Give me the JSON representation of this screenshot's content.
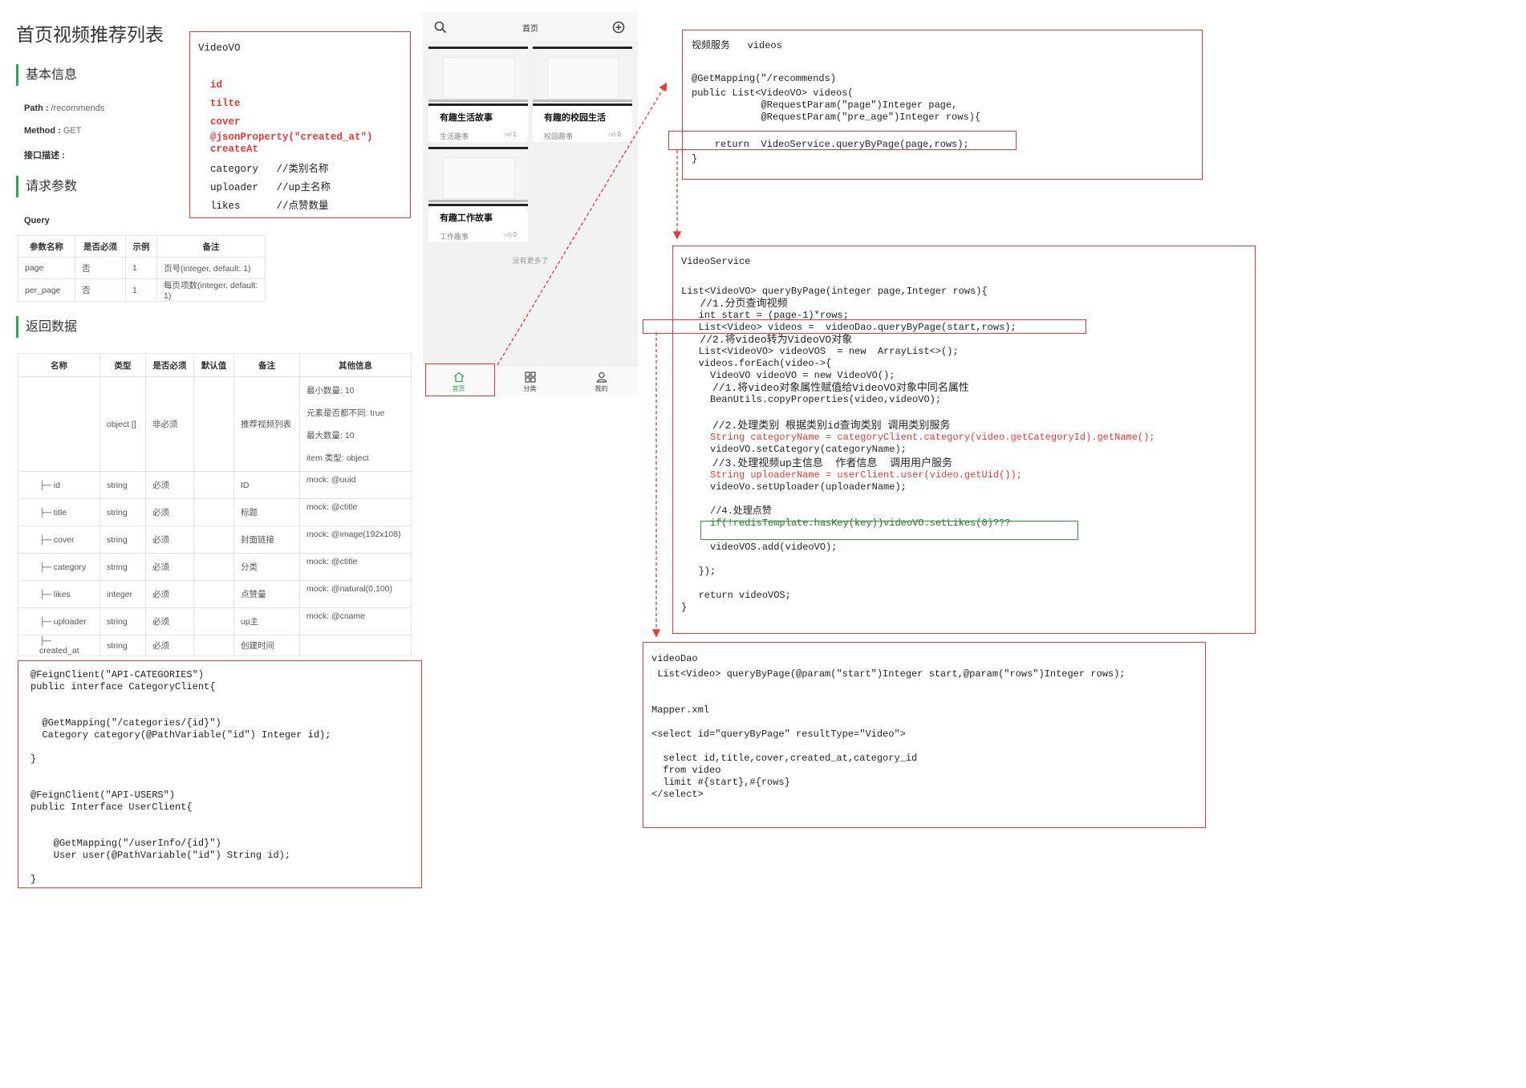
{
  "doc": {
    "title": "首页视频推荐列表",
    "basic_info_heading": "基本信息",
    "path_label": "Path :",
    "path_value": "/recommends",
    "method_label": "Method :",
    "method_value": "GET",
    "desc_label": "接口描述 :",
    "request_params_heading": "请求参数",
    "query_label": "Query",
    "query_table": {
      "headers": [
        "参数名称",
        "是否必须",
        "示例",
        "备注"
      ],
      "rows": [
        [
          "page",
          "否",
          "1",
          "页号(integer, default: 1)"
        ],
        [
          "per_page",
          "否",
          "1",
          "每页项数(integer, default: 1)"
        ]
      ]
    },
    "response_heading": "返回数据",
    "response_table": {
      "headers": [
        "名称",
        "类型",
        "是否必须",
        "默认值",
        "备注",
        "其他信息"
      ],
      "root": {
        "type": "object []",
        "required": "非必须",
        "default": "",
        "note": "推荐视频列表",
        "other": [
          "最小数量: 10",
          "元素是否都不同: true",
          "最大数量: 10",
          "item 类型: object"
        ]
      },
      "rows": [
        [
          "├─ id",
          "string",
          "必须",
          "",
          "ID",
          "mock: @uuid"
        ],
        [
          "├─ title",
          "string",
          "必须",
          "",
          "标题",
          "mock: @ctitle"
        ],
        [
          "├─ cover",
          "string",
          "必须",
          "",
          "封面链接",
          "mock: @image(192x108)"
        ],
        [
          "├─ category",
          "string",
          "必须",
          "",
          "分类",
          "mock: @ctitle"
        ],
        [
          "├─ likes",
          "integer",
          "必须",
          "",
          "点赞量",
          "mock: @natural(0,100)"
        ],
        [
          "├─ uploader",
          "string",
          "必须",
          "",
          "up主",
          "mock: @cname"
        ],
        [
          "├─ created_at",
          "string",
          "必须",
          "",
          "创建时间",
          ""
        ]
      ]
    }
  },
  "videovo_box": {
    "lines": [
      "VideoVO",
      "",
      "  id",
      "  tilte",
      "  cover",
      "  @jsonProperty(\"created_at\")",
      "  createAt",
      "  category   //类别名称",
      "  uploader   //up主名称",
      "  likes      //点赞数量"
    ]
  },
  "phone": {
    "header_title": "首页",
    "cards": [
      {
        "title": "有趣生活故事",
        "category": "生活趣事",
        "likes": "1"
      },
      {
        "title": "有趣的校园生活",
        "category": "校园趣事",
        "likes": "0"
      },
      {
        "title": "有趣工作故事",
        "category": "工作趣事",
        "likes": "0"
      }
    ],
    "no_more": "没有更多了",
    "tabs": [
      {
        "label": "首页",
        "icon": "home-icon",
        "active": true
      },
      {
        "label": "分类",
        "icon": "grid-icon",
        "active": false
      },
      {
        "label": "我的",
        "icon": "user-icon",
        "active": false
      }
    ],
    "accent_color": "#2ea84f"
  },
  "controller_box": {
    "lines": [
      "视频服务   videos",
      "",
      "@GetMapping(\"/recommends)",
      "public List<VideoVO> videos(",
      "            @RequestParam(\"page\")Integer page,",
      "            @RequestParam(\"pre_age\")Integer rows){",
      "",
      "    return  VideoService.queryByPage(page,rows);",
      "}"
    ]
  },
  "service_box": {
    "lines": [
      "VideoService",
      "",
      "List<VideoVO> queryByPage(integer page,Integer rows){",
      "   //1.分页查询视频",
      "   int start = (page-1)*rows;",
      "   List<Video> videos =  videoDao.queryByPage(start,rows);",
      "   //2.将video转为VideoVO对象",
      "   List<VideoVO> videoVOS  = new  ArrayList<>();",
      "   videos.forEach(video->{",
      "     VideoVO videoVO = new VideoVO();",
      "     //1.将video对象属性赋值给VideoVO对象中同名属性",
      "     BeanUtils.copyProperties(video,videoVO);",
      "",
      "     //2.处理类别 根据类别id查询类别 调用类别服务",
      "     String categoryName = categoryClient.category(video.getCategoryId).getName();",
      "     videoVO.setCategory(categoryName);",
      "     //3.处理视频up主信息  作者信息  调用用户服务",
      "     String uploaderName = userClient.user(video.getUid());",
      "     videoVo.setUploader(uploaderName);",
      "",
      "     //4.处理点赞",
      "     if(!redisTemplate.hasKey(key))videoVO.setLikes(0)???",
      "",
      "     videoVOS.add(videoVO);",
      "",
      "   });",
      "",
      "   return videoVOS;",
      "}"
    ]
  },
  "dao_box": {
    "lines": [
      "videoDao",
      " List<Video> queryByPage(@param(\"start\")Integer start,@param(\"rows\")Integer rows);",
      "",
      "",
      "Mapper.xml",
      "",
      "<select id=\"queryByPage\" resultType=\"Video\">",
      "",
      "  select id,title,cover,created_at,category_id",
      "  from video",
      "  limit #{start},#{rows}",
      "</select>"
    ]
  },
  "feign_box": {
    "lines": [
      "@FeignClient(\"API-CATEGORIES\")",
      "public interface CategoryClient{",
      "",
      "",
      "  @GetMapping(\"/categories/{id}\")",
      "  Category category(@PathVariable(\"id\") Integer id);",
      "",
      "}",
      "",
      "",
      "@FeignClient(\"API-USERS\")",
      "public Interface UserClient{",
      "",
      "",
      "    @GetMapping(\"/userInfo/{id}\")",
      "    User user(@PathVariable(\"id\") String id);",
      "",
      "}"
    ]
  },
  "colors": {
    "highlight_red": "#e53935",
    "highlight_green": "#2e9a3a"
  }
}
